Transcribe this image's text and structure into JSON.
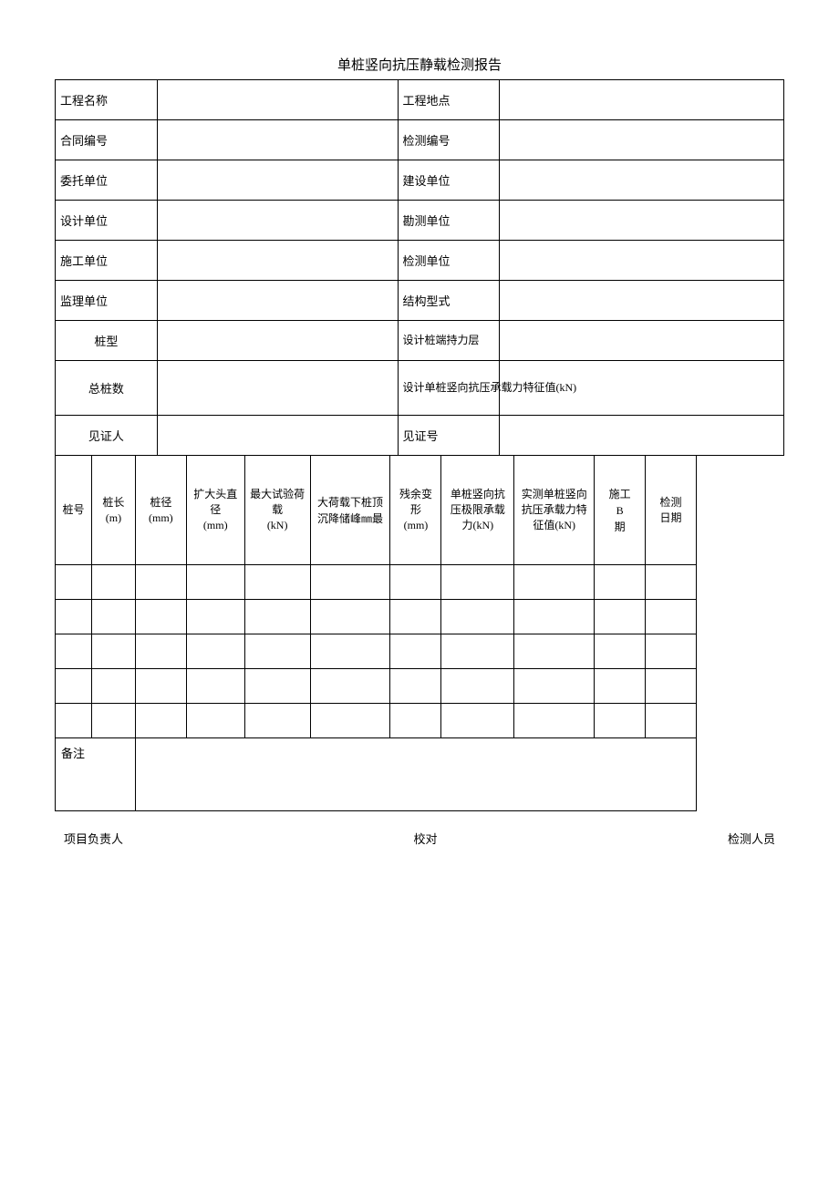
{
  "title": "单桩竖向抗压静载检测报告",
  "info_rows": [
    {
      "left_label": "工程名称",
      "left_value": "",
      "right_label": "工程地点",
      "right_value": ""
    },
    {
      "left_label": "合同编号",
      "left_value": "",
      "right_label": "检测编号",
      "right_value": ""
    },
    {
      "left_label": "委托单位",
      "left_value": "",
      "right_label": "建设单位",
      "right_value": ""
    },
    {
      "left_label": "设计单位",
      "left_value": "",
      "right_label": "勘测单位",
      "right_value": ""
    },
    {
      "left_label": "施工单位",
      "left_value": "",
      "right_label": "检测单位",
      "right_value": ""
    },
    {
      "left_label": "监理单位",
      "left_value": "",
      "right_label": "结构型式",
      "right_value": ""
    },
    {
      "left_label": "桩型",
      "left_value": "",
      "right_label": "设计桩端持力层",
      "right_value": ""
    },
    {
      "left_label": "总桩数",
      "left_value": "",
      "right_label": "设计单桩竖向抗压承载力特征值(kN)",
      "right_value": ""
    },
    {
      "left_label": "见证人",
      "left_value": "",
      "right_label": "见证号",
      "right_value": ""
    }
  ],
  "table_headers": {
    "pile_no": "桩号",
    "pile_length": "桩长\n(m)",
    "pile_diameter": "桩径\n(mm)",
    "expanded_diameter": "扩大头直径\n(mm)",
    "max_test_load": "最大试验荷载\n(kN)",
    "settlement": "大荷载下桩顶沉降储峰㎜最",
    "residual_deform": "残余变形\n(mm)",
    "limit_bearing": "单桩竖向抗压极限承载力(kN)",
    "actual_bearing": "实测单桩竖向抗压承载力特征值(kN)",
    "construction_period": "施工B期",
    "test_date": "检测日期"
  },
  "data_rows": [
    {
      "pile_no": "",
      "pile_length": "",
      "pile_diameter": "",
      "expanded_diameter": "",
      "max_test_load": "",
      "settlement": "",
      "residual_deform": "",
      "limit_bearing": "",
      "actual_bearing": "",
      "construction_period": "",
      "test_date": ""
    },
    {
      "pile_no": "",
      "pile_length": "",
      "pile_diameter": "",
      "expanded_diameter": "",
      "max_test_load": "",
      "settlement": "",
      "residual_deform": "",
      "limit_bearing": "",
      "actual_bearing": "",
      "construction_period": "",
      "test_date": ""
    },
    {
      "pile_no": "",
      "pile_length": "",
      "pile_diameter": "",
      "expanded_diameter": "",
      "max_test_load": "",
      "settlement": "",
      "residual_deform": "",
      "limit_bearing": "",
      "actual_bearing": "",
      "construction_period": "",
      "test_date": ""
    },
    {
      "pile_no": "",
      "pile_length": "",
      "pile_diameter": "",
      "expanded_diameter": "",
      "max_test_load": "",
      "settlement": "",
      "residual_deform": "",
      "limit_bearing": "",
      "actual_bearing": "",
      "construction_period": "",
      "test_date": ""
    },
    {
      "pile_no": "",
      "pile_length": "",
      "pile_diameter": "",
      "expanded_diameter": "",
      "max_test_load": "",
      "settlement": "",
      "residual_deform": "",
      "limit_bearing": "",
      "actual_bearing": "",
      "construction_period": "",
      "test_date": ""
    }
  ],
  "remarks_label": "备注",
  "footer": {
    "project_leader": "项目负责人",
    "reviewer": "校对",
    "inspector": "检测人员"
  }
}
